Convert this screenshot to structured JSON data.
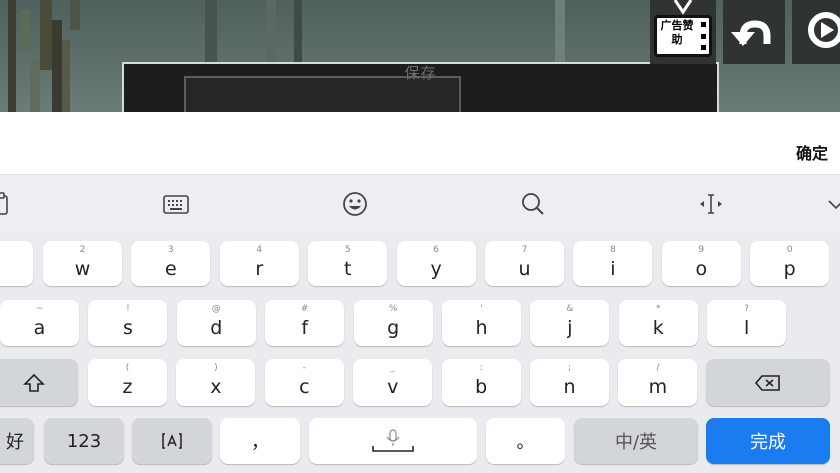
{
  "game": {
    "dialog_title": "保存",
    "ad_label": "广告赞助"
  },
  "input_bar": {
    "confirm_label": "确定"
  },
  "keyboard": {
    "row1": [
      {
        "hint": "2",
        "main": "w"
      },
      {
        "hint": "3",
        "main": "e"
      },
      {
        "hint": "4",
        "main": "r"
      },
      {
        "hint": "5",
        "main": "t"
      },
      {
        "hint": "6",
        "main": "y"
      },
      {
        "hint": "7",
        "main": "u"
      },
      {
        "hint": "8",
        "main": "i"
      },
      {
        "hint": "9",
        "main": "o"
      },
      {
        "hint": "0",
        "main": "p"
      }
    ],
    "row2": [
      {
        "hint": "~",
        "main": "a"
      },
      {
        "hint": "!",
        "main": "s"
      },
      {
        "hint": "@",
        "main": "d"
      },
      {
        "hint": "#",
        "main": "f"
      },
      {
        "hint": "%",
        "main": "g"
      },
      {
        "hint": "'",
        "main": "h"
      },
      {
        "hint": "&",
        "main": "j"
      },
      {
        "hint": "*",
        "main": "k"
      },
      {
        "hint": "?",
        "main": "l"
      }
    ],
    "row3": [
      {
        "hint": "(",
        "main": "z"
      },
      {
        "hint": ")",
        "main": "x"
      },
      {
        "hint": "-",
        "main": "c"
      },
      {
        "hint": "_",
        "main": "v"
      },
      {
        "hint": ":",
        "main": "b"
      },
      {
        "hint": ";",
        "main": "n"
      },
      {
        "hint": "/",
        "main": "m"
      }
    ],
    "row4": {
      "partial_left": "好",
      "num_label": "123",
      "comma": "，",
      "period": "。",
      "lang_switch": "中/英",
      "done_label": "完成"
    }
  },
  "colors": {
    "accent": "#1a7cf0",
    "keyboard_bg": "#e9ebee",
    "key_bg": "#ffffff",
    "function_key_bg": "#d2d5da"
  }
}
